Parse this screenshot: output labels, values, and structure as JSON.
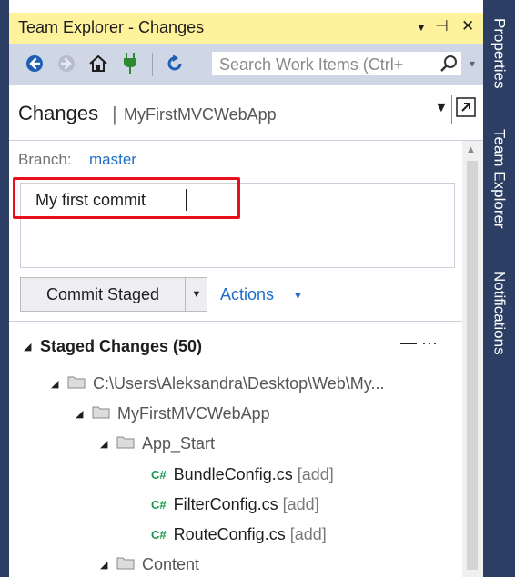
{
  "window": {
    "title": "Team Explorer - Changes",
    "title_controls": {
      "dropdown": "▼",
      "pin": "⊣",
      "close": "✕"
    }
  },
  "side_tabs": [
    "Properties",
    "Team Explorer",
    "Notifications"
  ],
  "toolbar": {
    "search_placeholder": "Search Work Items (Ctrl+",
    "icons": [
      "back-icon",
      "forward-icon",
      "home-icon",
      "connect-icon",
      "refresh-icon"
    ]
  },
  "header": {
    "title": "Changes",
    "separator": "|",
    "repo": "MyFirstMVCWebApp"
  },
  "branch": {
    "label": "Branch:",
    "name": "master"
  },
  "commit": {
    "message": "My first commit",
    "button_label": "Commit Staged",
    "actions_label": "Actions"
  },
  "staged": {
    "title": "Staged Changes (50)",
    "menu": "— ···",
    "tree": [
      {
        "type": "folder",
        "name": "C:\\Users\\Aleksandra\\Desktop\\Web\\My..."
      },
      {
        "type": "folder",
        "name": "MyFirstMVCWebApp"
      },
      {
        "type": "folder",
        "name": "App_Start"
      },
      {
        "type": "file",
        "name": "BundleConfig.cs",
        "status": "[add]"
      },
      {
        "type": "file",
        "name": "FilterConfig.cs",
        "status": "[add]"
      },
      {
        "type": "file",
        "name": "RouteConfig.cs",
        "status": "[add]"
      },
      {
        "type": "folder",
        "name": "Content"
      }
    ]
  },
  "colors": {
    "title_bar": "#fff29d",
    "side_bar": "#2c3e63",
    "link": "#1e6fc8",
    "highlight": "#e8101a",
    "cs_icon": "#179a4e"
  }
}
